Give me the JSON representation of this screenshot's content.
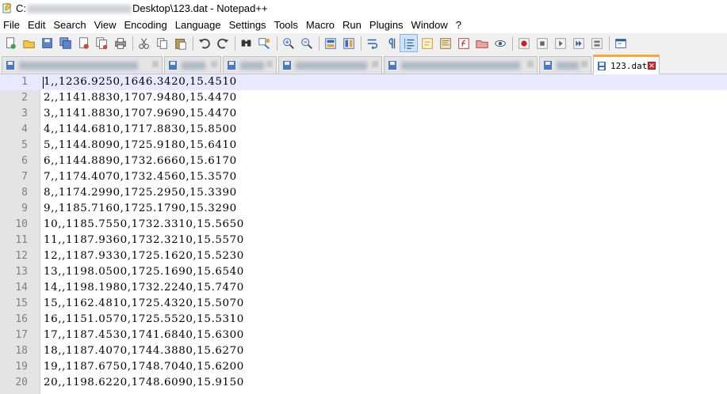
{
  "window": {
    "title_prefix": "C:",
    "title_suffix": "Desktop\\123.dat - Notepad++"
  },
  "menu": [
    "File",
    "Edit",
    "Search",
    "View",
    "Encoding",
    "Language",
    "Settings",
    "Tools",
    "Macro",
    "Run",
    "Plugins",
    "Window",
    "?"
  ],
  "toolbar": [
    {
      "icon": "new-file-icon"
    },
    {
      "icon": "open-file-icon"
    },
    {
      "icon": "save-icon"
    },
    {
      "icon": "save-all-icon"
    },
    {
      "icon": "close-icon"
    },
    {
      "icon": "close-all-icon"
    },
    {
      "icon": "print-icon"
    },
    {
      "sep": true
    },
    {
      "icon": "cut-icon"
    },
    {
      "icon": "copy-icon"
    },
    {
      "icon": "paste-icon"
    },
    {
      "sep": true
    },
    {
      "icon": "undo-icon"
    },
    {
      "icon": "redo-icon"
    },
    {
      "sep": true
    },
    {
      "icon": "find-icon"
    },
    {
      "icon": "replace-icon"
    },
    {
      "sep": true
    },
    {
      "icon": "zoom-in-icon"
    },
    {
      "icon": "zoom-out-icon"
    },
    {
      "sep": true
    },
    {
      "icon": "sync-vertical-icon"
    },
    {
      "icon": "sync-horizontal-icon"
    },
    {
      "sep": true
    },
    {
      "icon": "word-wrap-icon"
    },
    {
      "icon": "show-all-chars-icon"
    },
    {
      "icon": "indent-guide-icon",
      "active": true
    },
    {
      "icon": "user-language-icon"
    },
    {
      "icon": "doc-map-icon"
    },
    {
      "icon": "function-list-icon"
    },
    {
      "icon": "folder-workspace-icon"
    },
    {
      "icon": "monitoring-icon"
    },
    {
      "sep": true
    },
    {
      "icon": "record-macro-icon"
    },
    {
      "icon": "stop-macro-icon"
    },
    {
      "icon": "play-macro-icon"
    },
    {
      "icon": "run-macro-multiple-icon"
    },
    {
      "icon": "save-macro-icon"
    },
    {
      "sep": true
    },
    {
      "icon": "launch-icon"
    }
  ],
  "tabs": {
    "active_label": "123.dat"
  },
  "editor": {
    "lines": [
      "1,,1236.9250,1646.3420,15.4510",
      "2,,1141.8830,1707.9480,15.4470",
      "3,,1141.8830,1707.9690,15.4470",
      "4,,1144.6810,1717.8830,15.8500",
      "5,,1144.8090,1725.9180,15.6410",
      "6,,1144.8890,1732.6660,15.6170",
      "7,,1174.4070,1732.4560,15.3570",
      "8,,1174.2990,1725.2950,15.3390",
      "9,,1185.7160,1725.1790,15.3290",
      "10,,1185.7550,1732.3310,15.5650",
      "11,,1187.9360,1732.3210,15.5570",
      "12,,1187.9330,1725.1620,15.5230",
      "13,,1198.0500,1725.1690,15.6540",
      "14,,1198.1980,1732.2240,15.7470",
      "15,,1162.4810,1725.4320,15.5070",
      "16,,1151.0570,1725.5520,15.5310",
      "17,,1187.4530,1741.6840,15.6300",
      "18,,1187.4070,1744.3880,15.6270",
      "19,,1187.6750,1748.7040,15.6200",
      "20,,1198.6220,1748.6090,15.9150"
    ],
    "line_numbers": [
      "1",
      "2",
      "3",
      "4",
      "5",
      "6",
      "7",
      "8",
      "9",
      "10",
      "11",
      "12",
      "13",
      "14",
      "15",
      "16",
      "17",
      "18",
      "19",
      "20"
    ]
  }
}
